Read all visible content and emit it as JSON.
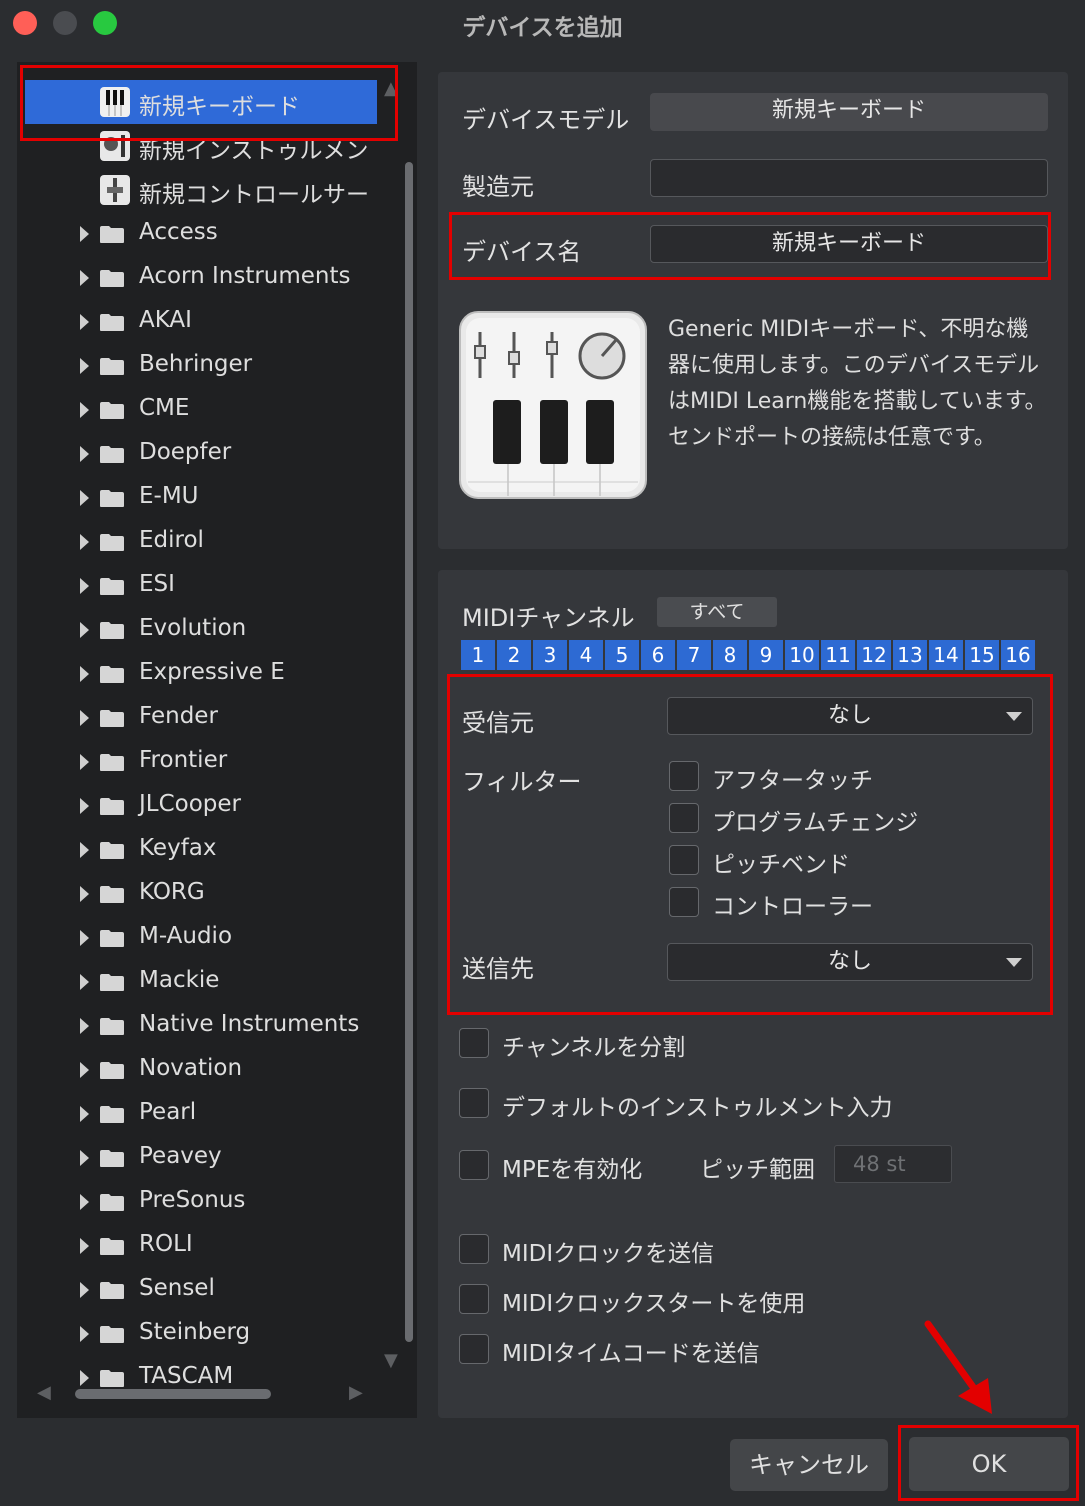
{
  "window": {
    "title": "デバイスを追加",
    "traffic_lights": {
      "close": "#ff5f57",
      "minimize": "#4a4c50",
      "zoom": "#28c940"
    }
  },
  "device_list": {
    "items": [
      {
        "label": "新規キーボード",
        "icon": "piano-keyboard-icon",
        "selected": true
      },
      {
        "label": "新規インストゥルメン",
        "icon": "instrument-icon"
      },
      {
        "label": "新規コントロールサー",
        "icon": "control-surface-icon"
      },
      {
        "label": "Access",
        "icon": "folder-icon"
      },
      {
        "label": "Acorn Instruments",
        "icon": "folder-icon"
      },
      {
        "label": "AKAI",
        "icon": "folder-icon"
      },
      {
        "label": "Behringer",
        "icon": "folder-icon"
      },
      {
        "label": "CME",
        "icon": "folder-icon"
      },
      {
        "label": "Doepfer",
        "icon": "folder-icon"
      },
      {
        "label": "E-MU",
        "icon": "folder-icon"
      },
      {
        "label": "Edirol",
        "icon": "folder-icon"
      },
      {
        "label": "ESI",
        "icon": "folder-icon"
      },
      {
        "label": "Evolution",
        "icon": "folder-icon"
      },
      {
        "label": "Expressive E",
        "icon": "folder-icon"
      },
      {
        "label": "Fender",
        "icon": "folder-icon"
      },
      {
        "label": "Frontier",
        "icon": "folder-icon"
      },
      {
        "label": "JLCooper",
        "icon": "folder-icon"
      },
      {
        "label": "Keyfax",
        "icon": "folder-icon"
      },
      {
        "label": "KORG",
        "icon": "folder-icon"
      },
      {
        "label": "M-Audio",
        "icon": "folder-icon"
      },
      {
        "label": "Mackie",
        "icon": "folder-icon"
      },
      {
        "label": "Native Instruments",
        "icon": "folder-icon"
      },
      {
        "label": "Novation",
        "icon": "folder-icon"
      },
      {
        "label": "Pearl",
        "icon": "folder-icon"
      },
      {
        "label": "Peavey",
        "icon": "folder-icon"
      },
      {
        "label": "PreSonus",
        "icon": "folder-icon"
      },
      {
        "label": "ROLI",
        "icon": "folder-icon"
      },
      {
        "label": "Sensel",
        "icon": "folder-icon"
      },
      {
        "label": "Steinberg",
        "icon": "folder-icon"
      },
      {
        "label": "TASCAM",
        "icon": "folder-icon"
      }
    ]
  },
  "device_info": {
    "model_label": "デバイスモデル",
    "model_value": "新規キーボード",
    "manufacturer_label": "製造元",
    "manufacturer_value": "",
    "name_label": "デバイス名",
    "name_value": "新規キーボード",
    "description": "Generic MIDIキーボード、不明な機器に使用します。このデバイスモデルはMIDI Learn機能を搭載しています。センドポートの接続は任意です。"
  },
  "midi": {
    "channel_label": "MIDIチャンネル",
    "all_button": "すべて",
    "channels": [
      "1",
      "2",
      "3",
      "4",
      "5",
      "6",
      "7",
      "8",
      "9",
      "10",
      "11",
      "12",
      "13",
      "14",
      "15",
      "16"
    ],
    "receive_label": "受信元",
    "receive_value": "なし",
    "filter_label": "フィルター",
    "filters": [
      "アフタータッチ",
      "プログラムチェンジ",
      "ピッチベンド",
      "コントローラー"
    ],
    "send_label": "送信先",
    "send_value": "なし",
    "split_channels": "チャンネルを分割",
    "default_instrument_input": "デフォルトのインストゥルメント入力",
    "enable_mpe": "MPEを有効化",
    "pitch_range_label": "ピッチ範囲",
    "pitch_range_placeholder": "48 st",
    "send_clock": "MIDIクロックを送信",
    "use_clock_start": "MIDIクロックスタートを使用",
    "send_timecode": "MIDIタイムコードを送信"
  },
  "footer": {
    "cancel": "キャンセル",
    "ok": "OK"
  },
  "colors": {
    "selection": "#2f6ad8",
    "channel_active": "#2d6ad3",
    "highlight_box": "#e30000"
  }
}
